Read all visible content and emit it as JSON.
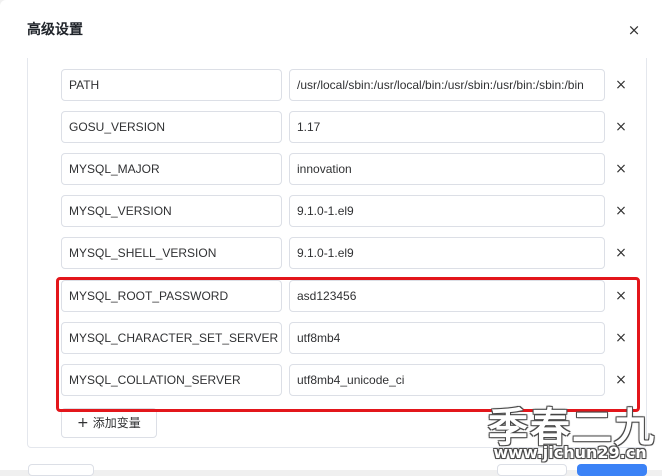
{
  "dialog": {
    "title": "高级设置",
    "close_glyph": "×"
  },
  "env_vars": [
    {
      "key": "PATH",
      "value": "/usr/local/sbin:/usr/local/bin:/usr/sbin:/usr/bin:/sbin:/bin"
    },
    {
      "key": "GOSU_VERSION",
      "value": "1.17"
    },
    {
      "key": "MYSQL_MAJOR",
      "value": "innovation"
    },
    {
      "key": "MYSQL_VERSION",
      "value": "9.1.0-1.el9"
    },
    {
      "key": "MYSQL_SHELL_VERSION",
      "value": "9.1.0-1.el9"
    },
    {
      "key": "MYSQL_ROOT_PASSWORD",
      "value": "asd123456"
    },
    {
      "key": "MYSQL_CHARACTER_SET_SERVER",
      "value": "utf8mb4"
    },
    {
      "key": "MYSQL_COLLATION_SERVER",
      "value": "utf8mb4_unicode_ci"
    }
  ],
  "remove_glyph": "×",
  "add_button": {
    "plus": "+",
    "label": "添加变量"
  },
  "highlight_color": "#e3161b",
  "watermark": {
    "text": "季春二九",
    "url": "www.jichun29.cn"
  }
}
